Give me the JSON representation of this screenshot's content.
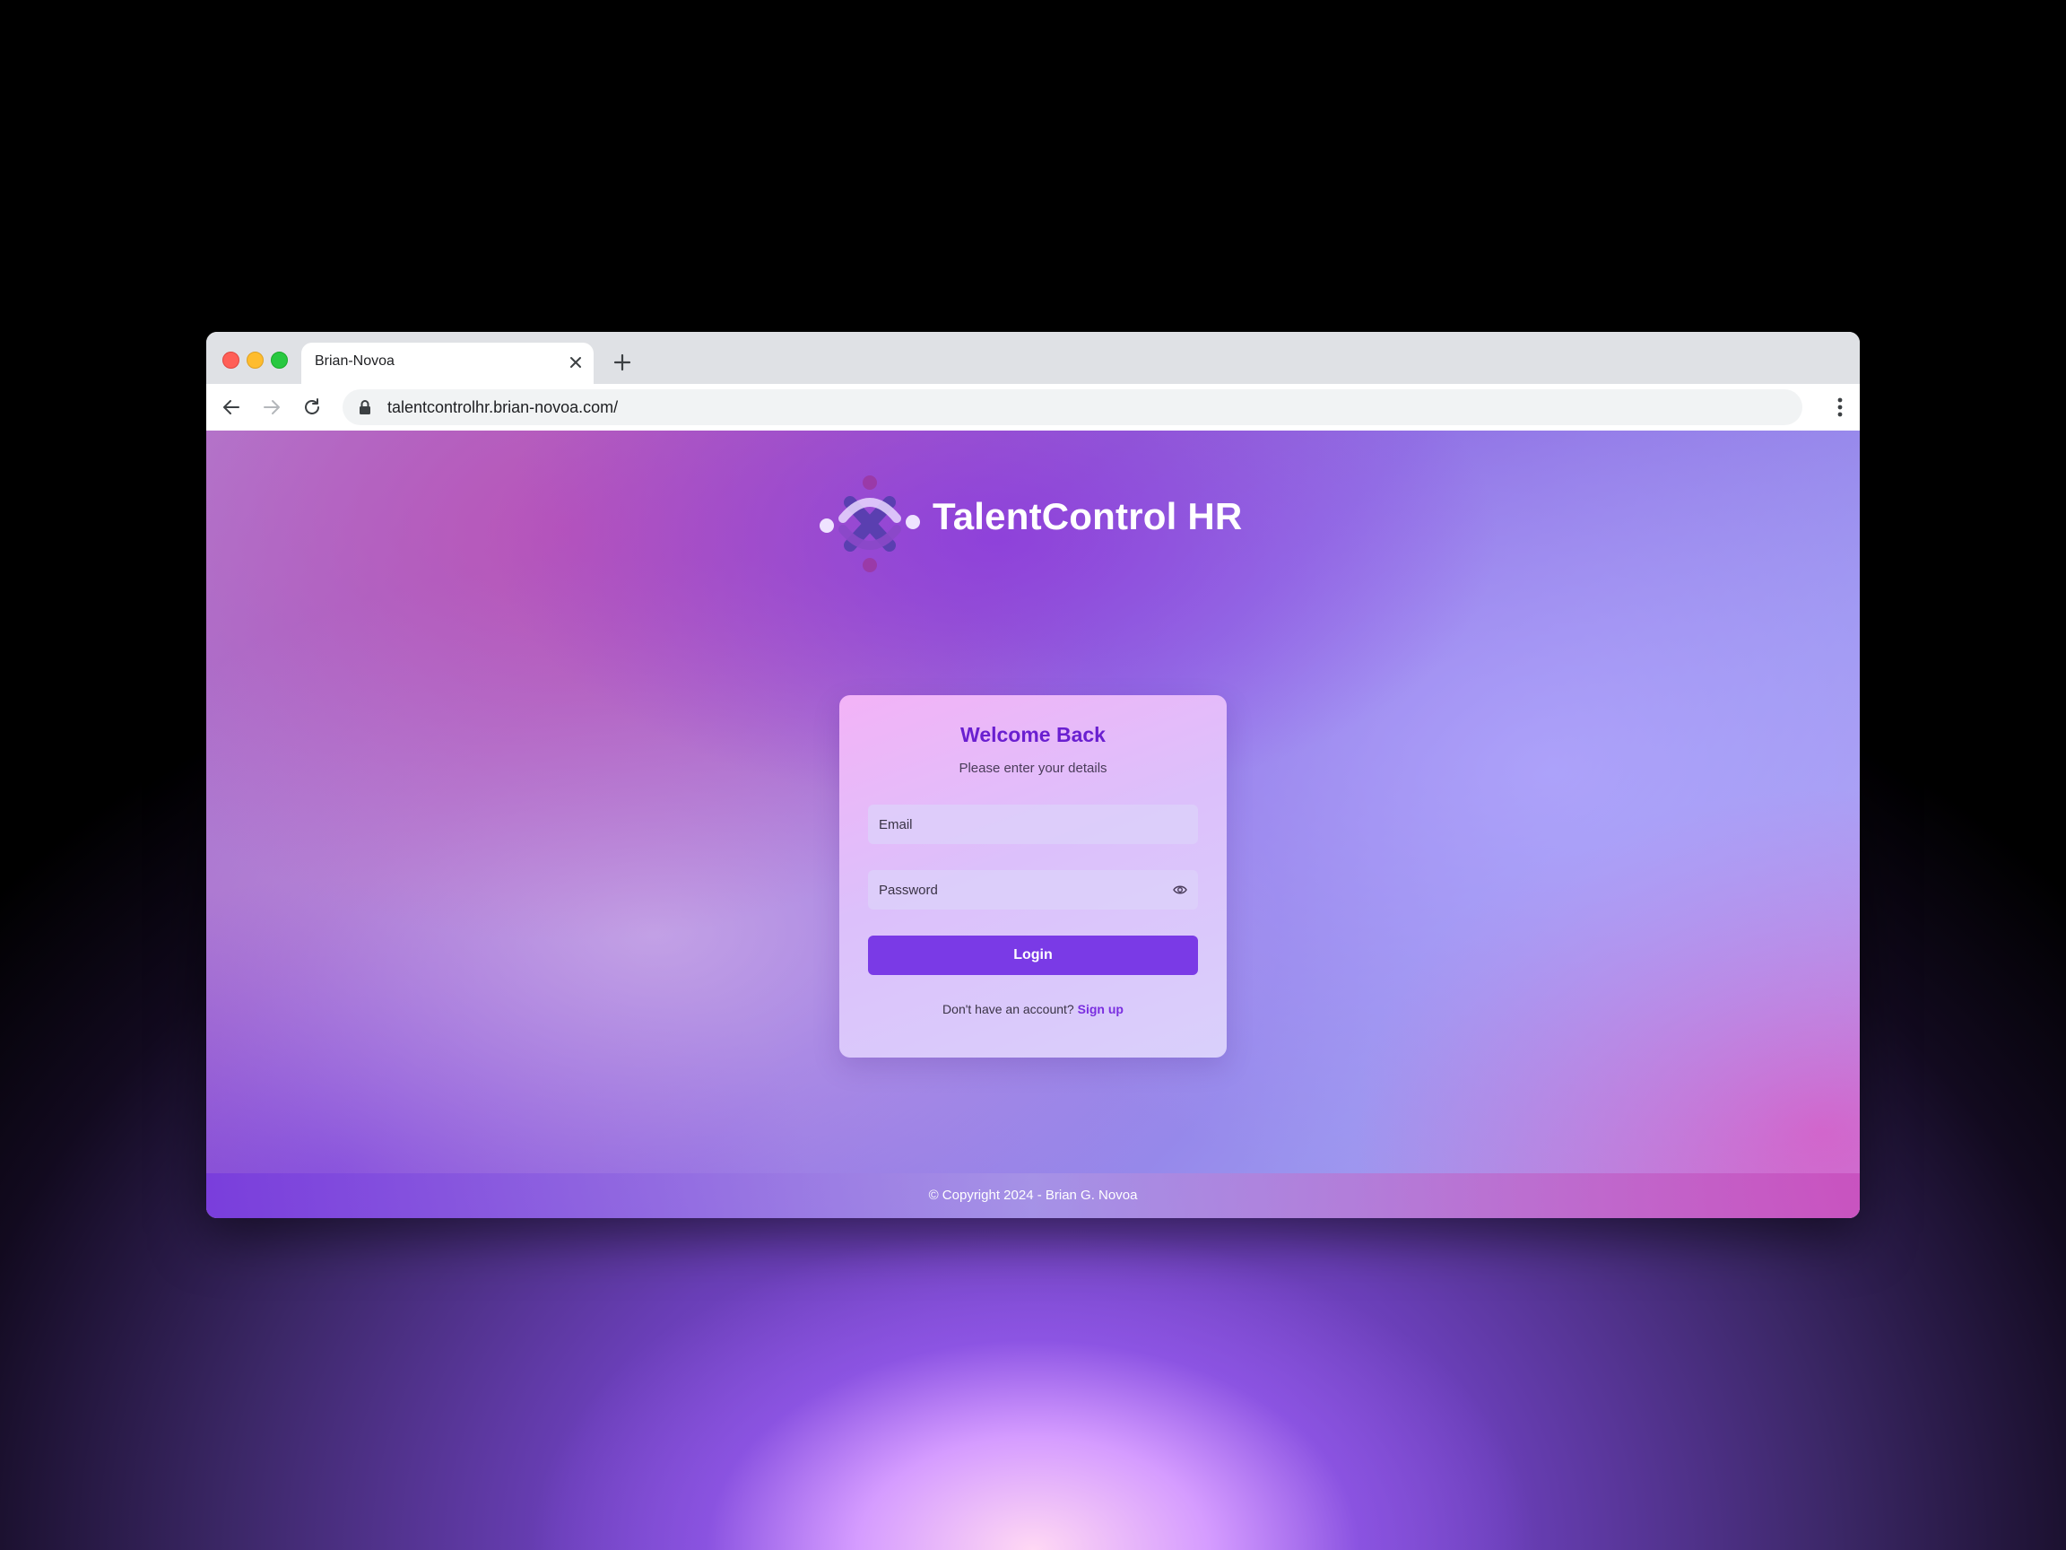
{
  "browser": {
    "tab_title": "Brian-Novoa",
    "url": "talentcontrolhr.brian-novoa.com/"
  },
  "brand": {
    "name": "TalentControl HR"
  },
  "login": {
    "title": "Welcome Back",
    "subtitle": "Please enter your details",
    "email_placeholder": "Email",
    "password_placeholder": "Password",
    "button_label": "Login",
    "signup_prompt": "Don't have an account?",
    "signup_link": "Sign up"
  },
  "footer": {
    "text": "© Copyright 2024 - Brian G. Novoa"
  },
  "colors": {
    "accent": "#7a3ae6",
    "title": "#6a1fd0"
  }
}
